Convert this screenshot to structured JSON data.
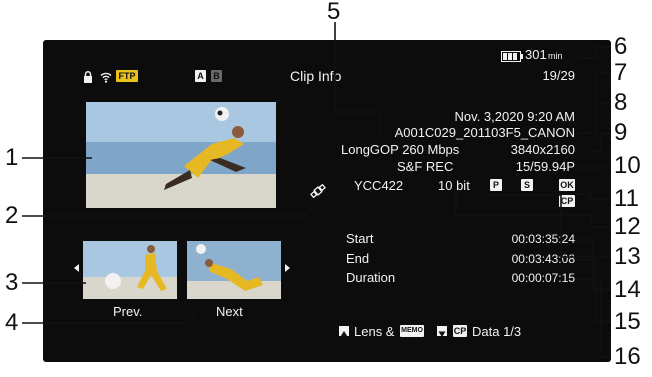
{
  "top_bar": {
    "ftp_badge": "FTP",
    "slot_a": "A",
    "slot_b": "B",
    "screen_title": "Clip Info",
    "battery_time": "301",
    "battery_unit": "min",
    "clip_counter": "19/29"
  },
  "clip_info": {
    "date_time": "Nov. 3,2020  9:20 AM",
    "clip_name": "A001C029_201103F5_CANON",
    "codec_bitrate": "LongGOP 260 Mbps",
    "resolution": "3840x2160",
    "sf_rec": "S&F REC",
    "frame_rate": "15/59.94P",
    "color_sampling": "YCC422",
    "bit_depth": "10 bit",
    "mark_p": "P",
    "mark_s": "S",
    "mark_ok": "OK",
    "mark_cp": "CP"
  },
  "timecodes": {
    "start_label": "Start",
    "start_value": "00:03:35:24",
    "end_label": "End",
    "end_value": "00:03:43:08",
    "duration_label": "Duration",
    "duration_value": "00:00:07:15"
  },
  "nav": {
    "prev_label": "Prev.",
    "next_label": "Next"
  },
  "bottom_bar": {
    "lens_label": "Lens &",
    "memo_badge": "MEMO",
    "cp_badge": "CP",
    "data_label": "Data 1/3"
  },
  "callouts": [
    "1",
    "2",
    "3",
    "4",
    "5",
    "6",
    "7",
    "8",
    "9",
    "10",
    "11",
    "12",
    "13",
    "14",
    "15",
    "16"
  ],
  "icons": [
    "lock-icon",
    "wifi-icon",
    "battery-icon",
    "gps-icon",
    "left-arrow-icon",
    "right-arrow-icon",
    "up-arrow-icon",
    "down-arrow-icon"
  ],
  "colors": {
    "screen_bg": "#0c0c0c",
    "ftp_badge": "#e8c21a",
    "text": "#f2f2f2"
  }
}
